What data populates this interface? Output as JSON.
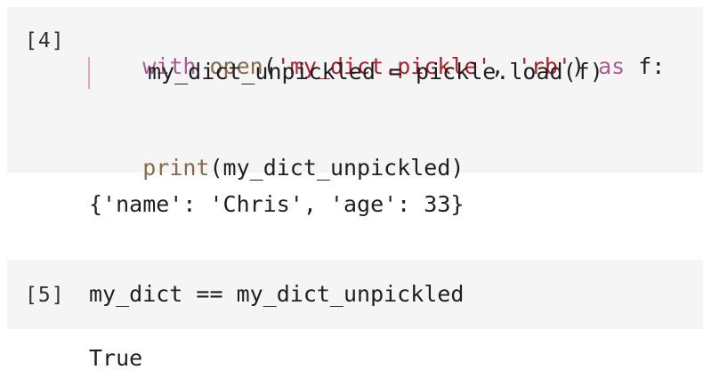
{
  "cells": [
    {
      "prompt": "[4]",
      "code": {
        "line1": {
          "kw_with": "with",
          "fn_open": "open",
          "paren_open": "(",
          "str_file": "'my_dict.pickle'",
          "comma": ", ",
          "str_mode": "'rb'",
          "paren_close": ")",
          "kw_as": "as",
          "target": "f:"
        },
        "line2": "my_dict_unpickled = pickle.load(f)",
        "line3": {
          "fn_print": "print",
          "args": "(my_dict_unpickled)"
        }
      },
      "output": "{'name': 'Chris', 'age': 33}"
    },
    {
      "prompt": "[5]",
      "code": {
        "line1": "my_dict == my_dict_unpickled"
      },
      "output": "True"
    }
  ]
}
